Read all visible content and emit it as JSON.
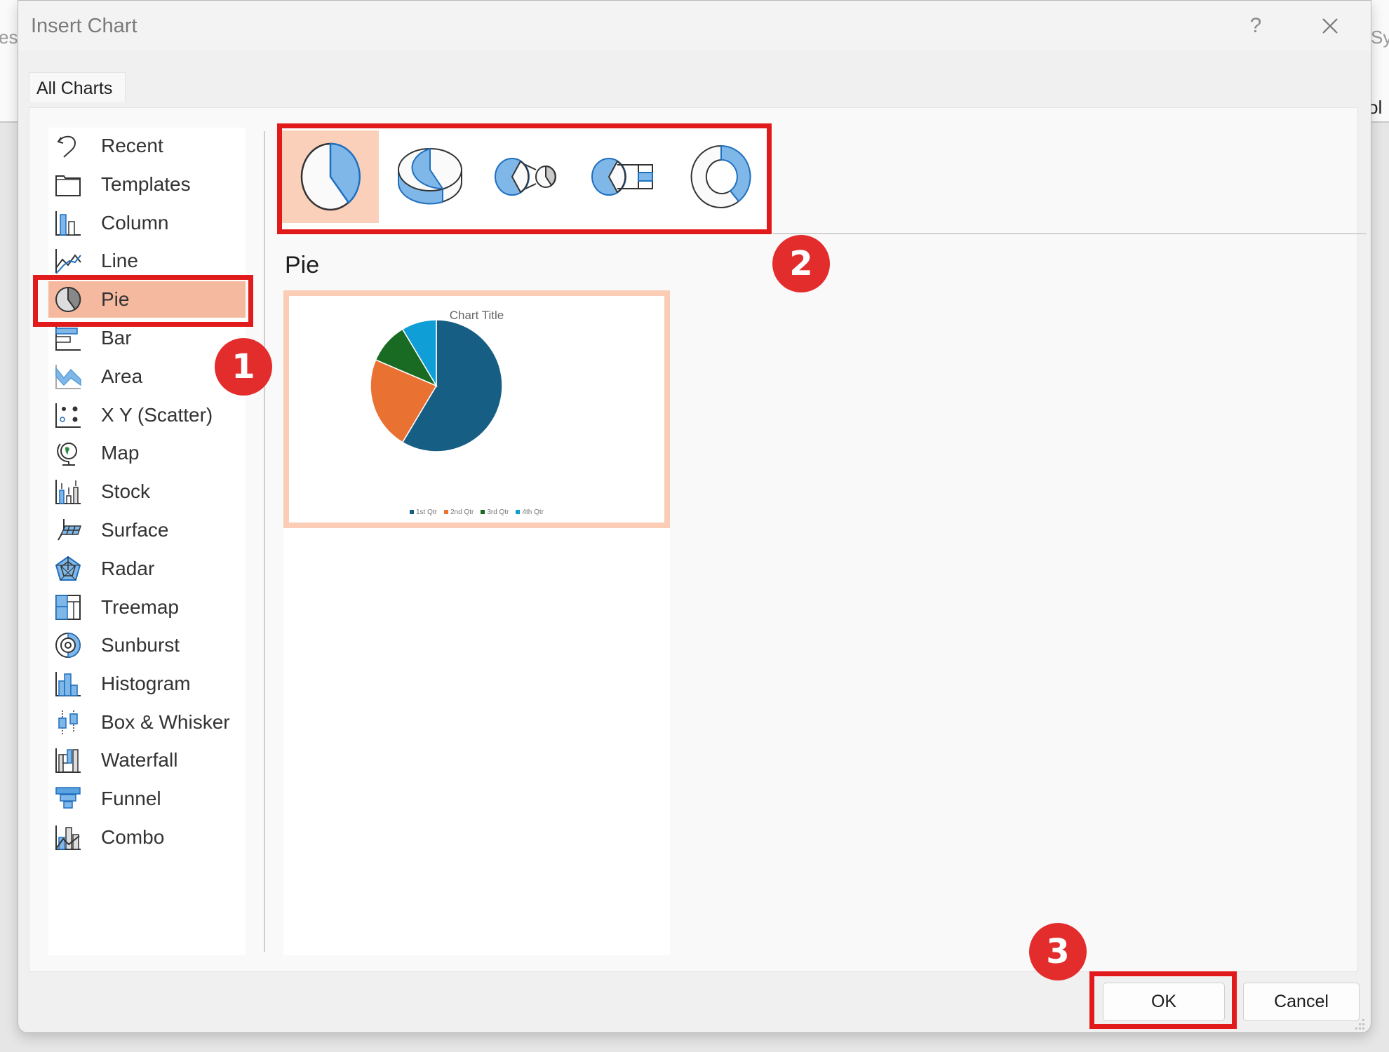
{
  "background": {
    "left_fragment": "es",
    "right_fragment_top": "Sy",
    "right_fragment_bottom": "ol"
  },
  "dialog": {
    "title": "Insert Chart",
    "help_label": "?",
    "close_icon": "close-icon",
    "tabs": [
      {
        "label": "All Charts",
        "active": true
      }
    ]
  },
  "chart_types": [
    {
      "label": "Recent",
      "icon": "recent-icon"
    },
    {
      "label": "Templates",
      "icon": "templates-folder-icon"
    },
    {
      "label": "Column",
      "icon": "column-chart-icon"
    },
    {
      "label": "Line",
      "icon": "line-chart-icon"
    },
    {
      "label": "Pie",
      "icon": "pie-chart-icon",
      "selected": true
    },
    {
      "label": "Bar",
      "icon": "bar-chart-icon"
    },
    {
      "label": "Area",
      "icon": "area-chart-icon"
    },
    {
      "label": "X Y (Scatter)",
      "icon": "scatter-chart-icon"
    },
    {
      "label": "Map",
      "icon": "map-globe-icon"
    },
    {
      "label": "Stock",
      "icon": "stock-chart-icon"
    },
    {
      "label": "Surface",
      "icon": "surface-chart-icon"
    },
    {
      "label": "Radar",
      "icon": "radar-chart-icon"
    },
    {
      "label": "Treemap",
      "icon": "treemap-chart-icon"
    },
    {
      "label": "Sunburst",
      "icon": "sunburst-chart-icon"
    },
    {
      "label": "Histogram",
      "icon": "histogram-chart-icon"
    },
    {
      "label": "Box & Whisker",
      "icon": "box-whisker-chart-icon"
    },
    {
      "label": "Waterfall",
      "icon": "waterfall-chart-icon"
    },
    {
      "label": "Funnel",
      "icon": "funnel-chart-icon"
    },
    {
      "label": "Combo",
      "icon": "combo-chart-icon"
    }
  ],
  "subtypes": [
    {
      "name": "Pie",
      "icon": "pie-icon",
      "selected": true
    },
    {
      "name": "3-D Pie",
      "icon": "pie-3d-icon"
    },
    {
      "name": "Pie of Pie",
      "icon": "pie-of-pie-icon"
    },
    {
      "name": "Bar of Pie",
      "icon": "bar-of-pie-icon"
    },
    {
      "name": "Doughnut",
      "icon": "doughnut-icon"
    }
  ],
  "selected_subtype_heading": "Pie",
  "annotations": {
    "badges": [
      "1",
      "2",
      "3"
    ],
    "badge_color": "#e32d2d",
    "highlight_color": "#e11b1b"
  },
  "buttons": {
    "ok": "OK",
    "cancel": "Cancel"
  },
  "colors": {
    "selected_item_bg": "#f5b9a0",
    "selected_subtype_bg": "#fbd0bb",
    "icon_blue": "#7fb8e8"
  },
  "chart_data": {
    "type": "pie",
    "title": "Chart Title",
    "categories": [
      "1st Qtr",
      "2nd Qtr",
      "3rd Qtr",
      "4th Qtr"
    ],
    "values": [
      8.2,
      3.2,
      1.4,
      1.2
    ],
    "colors": [
      "#175e84",
      "#e97132",
      "#196b24",
      "#0f9ed5"
    ],
    "legend": "bottom",
    "start_angle_deg": 0,
    "direction": "clockwise"
  }
}
